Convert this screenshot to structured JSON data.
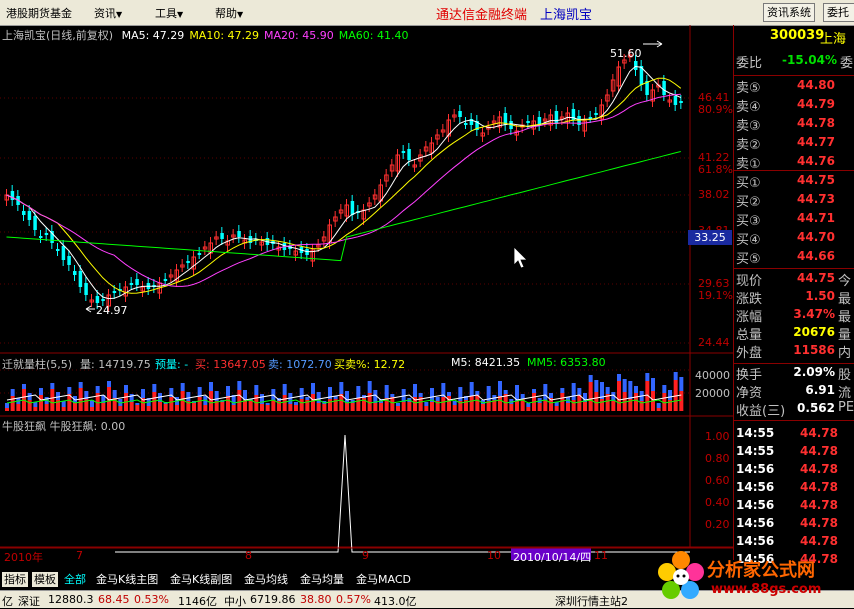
{
  "menu": {
    "items": [
      {
        "label": "港股期货基金"
      },
      {
        "label": "资讯"
      },
      {
        "label": "工具"
      },
      {
        "label": "帮助"
      }
    ],
    "app_title": "通达信金融终端",
    "stock_name": "上海凯宝",
    "buttons": [
      {
        "label": "资讯系统"
      },
      {
        "label": "委托"
      }
    ]
  },
  "main_chart": {
    "title": "上海凯宝(日线,前复权)",
    "ma": [
      {
        "label": "MA5: 47.29",
        "color": "#ffffff"
      },
      {
        "label": "MA10: 47.29",
        "color": "#ffff00"
      },
      {
        "label": "MA20: 45.90",
        "color": "#ff40ff"
      },
      {
        "label": "MA60: 41.40",
        "color": "#00ff00"
      }
    ],
    "high_label": "51.60",
    "low_label": "24.97",
    "price_axis": [
      {
        "price": "46.41",
        "pct": "80.9%"
      },
      {
        "price": "41.22",
        "pct": "61.8%"
      },
      {
        "price": "38.02",
        "pct": ""
      },
      {
        "price": "34.81",
        "pct": ""
      },
      {
        "price": "29.63",
        "pct": "19.1%"
      },
      {
        "price": "24.44",
        "pct": ""
      }
    ],
    "current_price_tag": "33.25"
  },
  "volume_chart": {
    "title": "迁就量柱(5,5)",
    "items": [
      {
        "label": "量: 14719.75",
        "color": "#c0c0c0"
      },
      {
        "label": "预量: -",
        "color": "#00ffff"
      },
      {
        "label": "买: 13647.05",
        "color": "#ff3030"
      },
      {
        "label": "卖: 1072.70",
        "color": "#5599ff"
      },
      {
        "label": "买卖%: 12.72",
        "color": "#ffff00"
      },
      {
        "label": "M5: 8421.35",
        "color": "#ffffff"
      },
      {
        "label": "MM5: 6353.80",
        "color": "#00ff00"
      }
    ],
    "axis": [
      "40000",
      "20000"
    ]
  },
  "indicator_chart": {
    "title": "牛股狂飙 牛股狂飙: 0.00",
    "axis": [
      "1.00",
      "0.80",
      "0.60",
      "0.40",
      "0.20"
    ]
  },
  "date_axis": {
    "labels": [
      "2010年",
      "7",
      "8",
      "9",
      "10",
      "11"
    ],
    "highlight": "2010/10/14/四"
  },
  "quote": {
    "code": "300039",
    "name": "上海",
    "weibi": {
      "label": "委比",
      "value": "-15.04%",
      "tail": "委"
    },
    "sells": [
      {
        "label": "卖⑤",
        "price": "44.80"
      },
      {
        "label": "卖④",
        "price": "44.79"
      },
      {
        "label": "卖③",
        "price": "44.78"
      },
      {
        "label": "卖②",
        "price": "44.77"
      },
      {
        "label": "卖①",
        "price": "44.76"
      }
    ],
    "buys": [
      {
        "label": "买①",
        "price": "44.75"
      },
      {
        "label": "买②",
        "price": "44.73"
      },
      {
        "label": "买③",
        "price": "44.71"
      },
      {
        "label": "买④",
        "price": "44.70"
      },
      {
        "label": "买⑤",
        "price": "44.66"
      }
    ],
    "stats": [
      {
        "label": "现价",
        "value": "44.75",
        "tail": "今",
        "cls": "red"
      },
      {
        "label": "涨跌",
        "value": "1.50",
        "tail": "最",
        "cls": "red"
      },
      {
        "label": "涨幅",
        "value": "3.47%",
        "tail": "最",
        "cls": "red"
      },
      {
        "label": "总量",
        "value": "20676",
        "tail": "量",
        "cls": "yellow"
      },
      {
        "label": "外盘",
        "value": "11586",
        "tail": "内",
        "cls": "red"
      },
      {
        "label": "换手",
        "value": "2.09%",
        "tail": "股",
        "cls": "white"
      },
      {
        "label": "净资",
        "value": "6.91",
        "tail": "流",
        "cls": "white"
      },
      {
        "label": "收益(三)",
        "value": "0.562",
        "tail": "PE",
        "cls": "white"
      }
    ],
    "ticks": [
      {
        "time": "14:55",
        "price": "44.78"
      },
      {
        "time": "14:55",
        "price": "44.78"
      },
      {
        "time": "14:56",
        "price": "44.78"
      },
      {
        "time": "14:56",
        "price": "44.78"
      },
      {
        "time": "14:56",
        "price": "44.78"
      },
      {
        "time": "14:56",
        "price": "44.78"
      },
      {
        "time": "14:56",
        "price": "44.78"
      },
      {
        "time": "14:56",
        "price": "44.78"
      }
    ]
  },
  "tabs": [
    {
      "label": "指标"
    },
    {
      "label": "模板"
    },
    {
      "label": "全部"
    },
    {
      "label": "金马K线主图"
    },
    {
      "label": "金马K线副图"
    },
    {
      "label": "金马均线"
    },
    {
      "label": "金马均量"
    },
    {
      "label": "金马MACD"
    }
  ],
  "status": [
    {
      "label": "亿"
    },
    {
      "label": "深证"
    },
    {
      "label": "12880.3"
    },
    {
      "label": "68.45"
    },
    {
      "label": "0.53%"
    },
    {
      "label": "1146亿"
    },
    {
      "label": "中小"
    },
    {
      "label": "6719.86"
    },
    {
      "label": "38.80"
    },
    {
      "label": "0.57%"
    },
    {
      "label": "413.0亿"
    },
    {
      "label": "深圳行情主站2"
    }
  ],
  "watermark": {
    "text": "分析家公式网",
    "url": "www.88gs.com"
  }
}
